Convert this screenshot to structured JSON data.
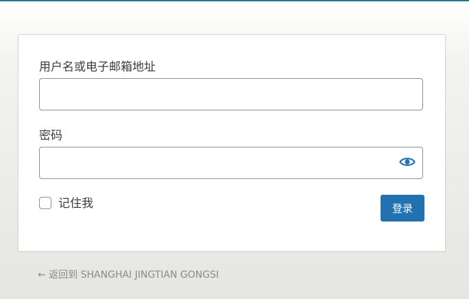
{
  "form": {
    "username_label": "用户名或电子邮箱地址",
    "username_value": "",
    "password_label": "密码",
    "password_value": "",
    "password_toggle_icon": "eye-icon",
    "remember_label": "记住我",
    "remember_checked": false,
    "submit_label": "登录"
  },
  "footer": {
    "back_link": "← 返回到 SHANGHAI JINGTIAN GONGSI"
  },
  "colors": {
    "accent": "#2271b1",
    "top_bar": "#2a6f8f",
    "eye_icon": "#2271b1"
  }
}
